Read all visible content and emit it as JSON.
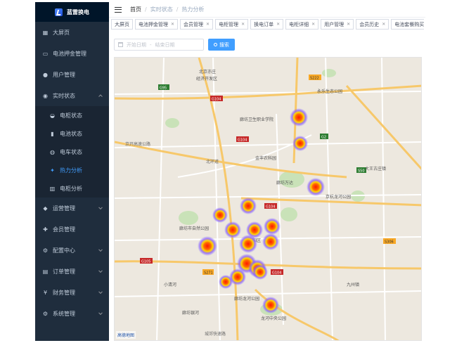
{
  "brand": {
    "title": "蓝雷换电"
  },
  "sidebar": {
    "items": [
      {
        "label": "大屏页",
        "icon": "dashboard-icon"
      },
      {
        "label": "电池押金管理",
        "icon": "card-icon"
      },
      {
        "label": "用户管理",
        "icon": "user-icon"
      },
      {
        "label": "实时状态",
        "icon": "location-icon",
        "open": true
      },
      {
        "label": "运营管理",
        "icon": "operation-icon"
      },
      {
        "label": "会员管理",
        "icon": "member-icon"
      },
      {
        "label": "配置中心",
        "icon": "config-icon"
      },
      {
        "label": "订单管理",
        "icon": "order-icon"
      },
      {
        "label": "财务管理",
        "icon": "finance-icon"
      },
      {
        "label": "系统管理",
        "icon": "system-icon"
      }
    ],
    "submenu": [
      {
        "label": "电柜状态",
        "icon": "cabinet-icon"
      },
      {
        "label": "电池状态",
        "icon": "battery-icon"
      },
      {
        "label": "电车状态",
        "icon": "pin-icon"
      },
      {
        "label": "热力分析",
        "icon": "heat-icon",
        "active": true
      },
      {
        "label": "电柜分析",
        "icon": "bar-chart-icon"
      }
    ]
  },
  "breadcrumb": {
    "home": "首页",
    "parent": "实时状态",
    "current": "热力分析"
  },
  "tags": [
    "大屏页",
    "电池押金管理",
    "会员管理",
    "电柜管理",
    "换电订单",
    "电柜详细",
    "用户管理",
    "会员历史",
    "电池套餐购买"
  ],
  "filter": {
    "start_placeholder": "开始日期",
    "end_placeholder": "结束日期",
    "search_label": "搜索"
  },
  "map": {
    "labels": {
      "l1": "北京亦庄",
      "l2": "经济开发区",
      "l3": "永乐生态公园",
      "l4": "廊坊卫生职业学院",
      "l5": "北环道",
      "l6": "金丰农科园",
      "l7": "廊坊万达",
      "l8": "廊坊市自然公园",
      "l9": "广阳区",
      "l10": "京杭大运河",
      "l11": "龙河中央公园",
      "l12": "万庄",
      "l13": "廊坊银河",
      "l14": "京杭龙河公园",
      "l15": "廊坊高新区",
      "l16": "大王古庄镇",
      "l17": "京开高速公路",
      "l18": "城郊快速路",
      "l19": "北旺乡",
      "l20": "小清河",
      "l21": "九州镇",
      "l22": "廊坊龙河公园",
      "l23": "京杭大道"
    },
    "roads": [
      "G104",
      "G95",
      "G2",
      "S222",
      "S50",
      "G105",
      "S271",
      "S306",
      "G104",
      "G104"
    ],
    "logo": "高德地图"
  }
}
